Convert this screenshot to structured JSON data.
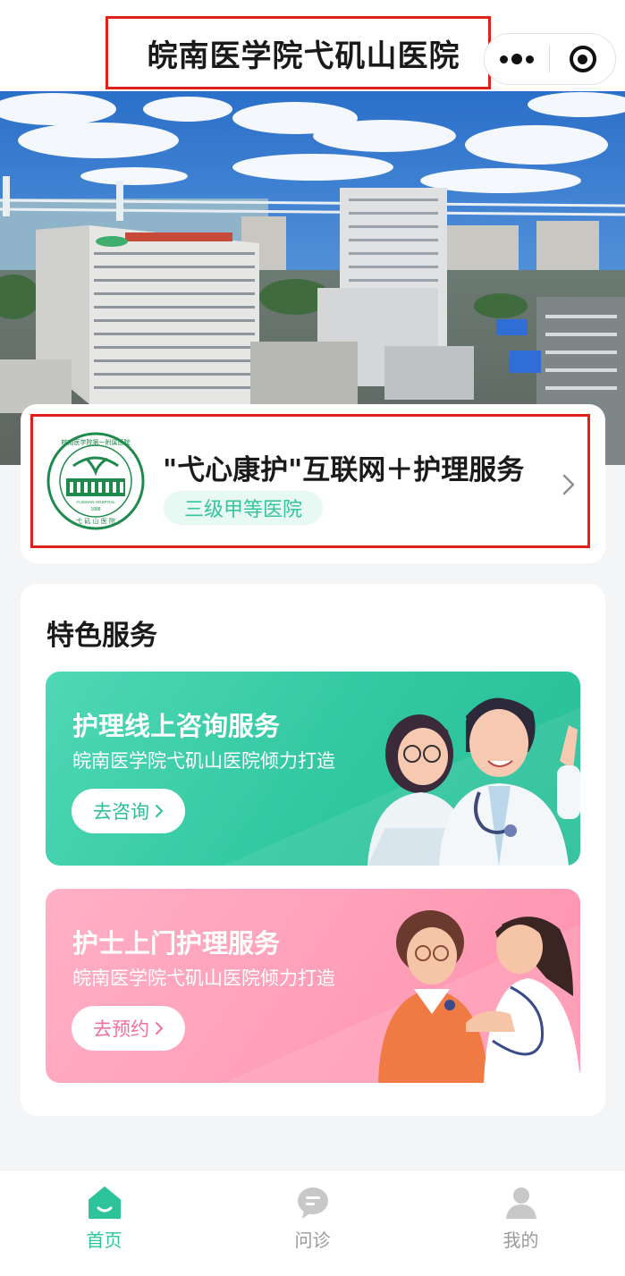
{
  "navbar": {
    "title": "皖南医学院弋矶山医院",
    "more_icon": "more-dots-icon",
    "close_icon": "target-circle-icon"
  },
  "banner": {
    "image": "hospital-aerial-photo"
  },
  "hospital_card": {
    "name": "\"弋心康护\"互联网＋护理服务",
    "tag": "三级甲等医院",
    "logo_text_top": "皖南医学院第一附属医院",
    "logo_text_en": "YIJISHAN HOSPITAL",
    "logo_year": "1888",
    "logo_text_bottom": "弋 矶 山 医 院",
    "chevron_icon": "chevron-right-icon"
  },
  "services": {
    "title": "特色服务",
    "items": [
      {
        "title": "护理线上咨询服务",
        "subtitle": "皖南医学院弋矶山医院倾力打造",
        "button": "去咨询",
        "color": "#33c9a3"
      },
      {
        "title": "护士上门护理服务",
        "subtitle": "皖南医学院弋矶山医院倾力打造",
        "button": "去预约",
        "color": "#ff9fb9"
      }
    ]
  },
  "tabbar": {
    "items": [
      {
        "label": "首页",
        "icon": "home-icon",
        "active": true
      },
      {
        "label": "问诊",
        "icon": "chat-icon",
        "active": false
      },
      {
        "label": "我的",
        "icon": "user-icon",
        "active": false
      }
    ],
    "active_color": "#2dc49b",
    "inactive_color": "#9a9a9a"
  }
}
